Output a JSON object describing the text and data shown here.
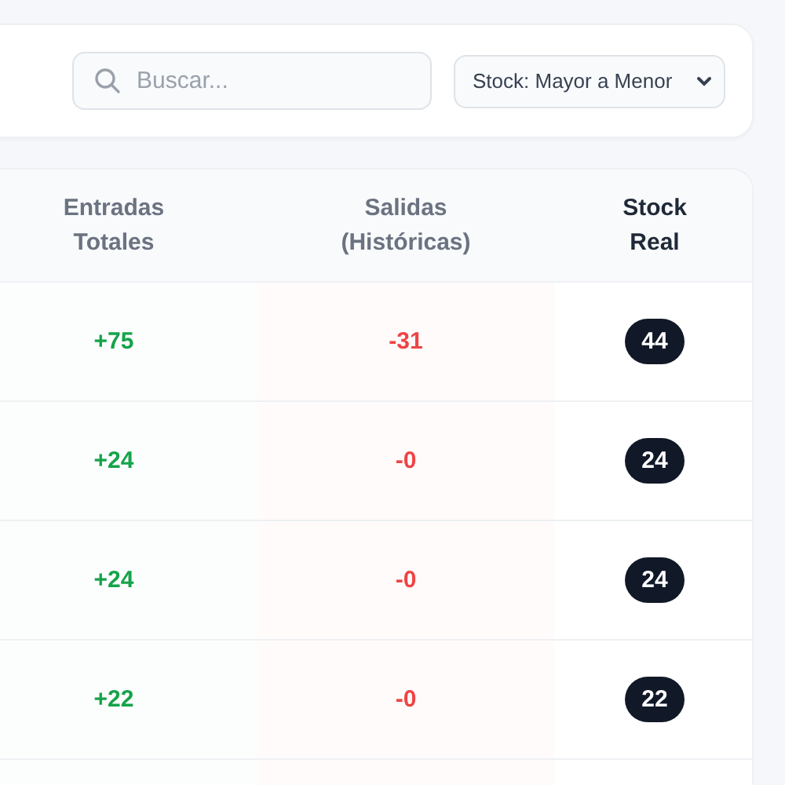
{
  "toolbar": {
    "search": {
      "placeholder": "Buscar..."
    },
    "sort_select": {
      "value": "Stock: Mayor a Menor"
    }
  },
  "table": {
    "columns": [
      {
        "label": "Entradas Totales",
        "kind": "in"
      },
      {
        "label": "Salidas (Históricas)",
        "kind": "out"
      },
      {
        "label": "Stock Real",
        "kind": "stock"
      }
    ],
    "rows": [
      {
        "entradas": "+75",
        "salidas": "-31",
        "stock": "44"
      },
      {
        "entradas": "+24",
        "salidas": "-0",
        "stock": "24"
      },
      {
        "entradas": "+24",
        "salidas": "-0",
        "stock": "24"
      },
      {
        "entradas": "+22",
        "salidas": "-0",
        "stock": "22"
      }
    ]
  }
}
